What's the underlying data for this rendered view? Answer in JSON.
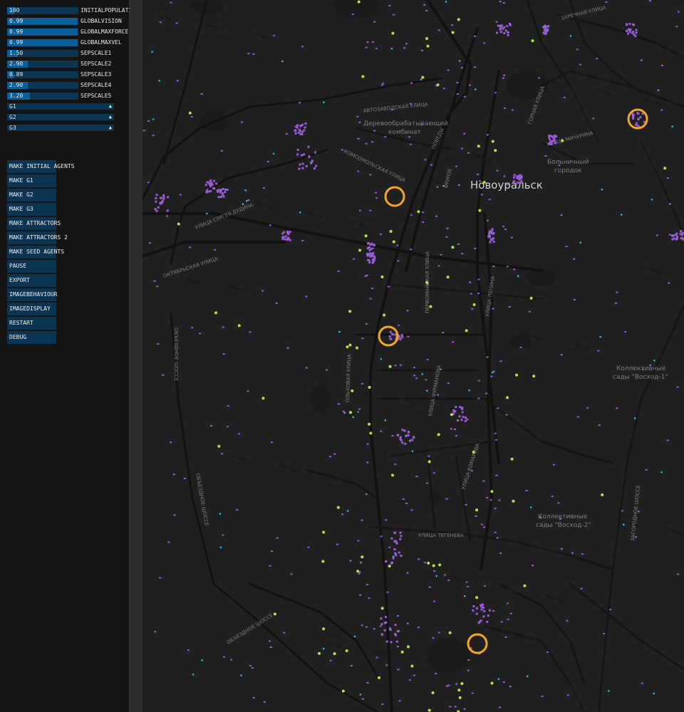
{
  "sliders": [
    {
      "value": "100",
      "level": 0.1,
      "label": "INITIALPOPULATION"
    },
    {
      "value": "0.99",
      "level": 0.99,
      "label": "GLOBALVISION"
    },
    {
      "value": "0.99",
      "level": 0.99,
      "label": "GLOBALMAXFORCE"
    },
    {
      "value": "0.99",
      "level": 0.99,
      "label": "GLOBALMAXVEL"
    },
    {
      "value": "1.50",
      "level": 0.15,
      "label": "SEPSCALE1"
    },
    {
      "value": "2.90",
      "level": 0.29,
      "label": "SEPSCALE2"
    },
    {
      "value": "0.89",
      "level": 0.09,
      "label": "SEPSCALE3"
    },
    {
      "value": "2.90",
      "level": 0.29,
      "label": "SEPSCALE4"
    },
    {
      "value": "3.20",
      "level": 0.32,
      "label": "SEPSCALE5"
    }
  ],
  "dropdowns": [
    {
      "label": "G1",
      "icon": "triangle-up-icon"
    },
    {
      "label": "G2",
      "icon": "triangle-up-icon"
    },
    {
      "label": "G3",
      "icon": "triangle-up-icon"
    }
  ],
  "buttons": [
    "MAKE INITIAL AGENTS",
    "MAKE G1",
    "MAKE G2",
    "MAKE G3",
    "MAKE ATTRACTORS",
    "MAKE ATTRACTORS 2",
    "MAKE SEED AGENTS",
    "PAUSE",
    "EXPORT",
    "IMAGEBEHAVIOUR",
    "IMAGEDISPLAY",
    "RESTART",
    "DEBUG"
  ],
  "map": {
    "city": "Новоуральск",
    "labels": {
      "avtozavodskaya": "АВТОЗАВОДСКАЯ УЛИЦА",
      "derevo1": "Деревообрабатывающий",
      "derevo2": "комбинат",
      "hospital1": "Больничный",
      "hospital2": "городок",
      "sady1_a": "Коллективные",
      "sady1_b": "сады \"Восход-1\"",
      "sady2_a": "Коллективные",
      "sady2_b": "сады \"Восход-2\"",
      "oktyabrskaya": "ОКТЯБРЬСКАЯ УЛИЦА",
      "sergeya": "УЛИЦА СЕРГЕЯ ДУДИНА",
      "obezdnoe1": "ОБЪЕЗДНОЕ ШОССЕ",
      "obezdnoe2": "ОБЪЕЗДНОЕ ШОССЕ",
      "obezdnoe3": "ОБЪЕЗДНОЕ ШОССЕ",
      "olkhovaya": "ОЛЬХОВАЯ УЛИЦА",
      "pervomayskaya": "ПЕРВОМАЙСКАЯ УЛИЦА",
      "furmanova": "УЛИЦА ФУРМАНОВА",
      "komarova": "УЛИЦА КОМАРОВА",
      "tegeneva": "УЛИЦА ТЕГЕНЕВА",
      "lenina": "УЛИЦА ЛЕНИНА",
      "zagorodnoe": "ЗАГОРОДНОЕ ШОССЕ",
      "michurina": "УЛИЦА МИЧУРИНА",
      "zarechnaya": "ЗАРЕЧНАЯ УЛИЦА",
      "komsomolskaya": "КОМСОМОЛЬСКАЯ УЛИЦА",
      "pobedy": "ПОБЕДЫ",
      "frunze": "ФРУНЗЕ",
      "gornaya": "ГОРНАЯ УЛИЦА"
    },
    "colors": {
      "background": "#202020",
      "road_major": "#121212",
      "road_minor": "#161616",
      "agent": "#9a5cd8",
      "attractor": "#b6e24a",
      "seed": "#33b8d8",
      "ring": "#f5a623"
    }
  }
}
